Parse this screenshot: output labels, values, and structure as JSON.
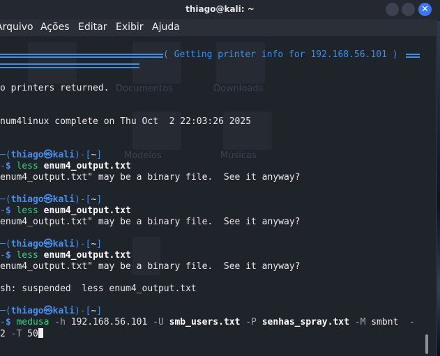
{
  "window": {
    "title": "thiago@kali: ~"
  },
  "menu": {
    "items": [
      "Arquivo",
      "Ações",
      "Editar",
      "Exibir",
      "Ajuda"
    ]
  },
  "desktop_ghost": {
    "documentos": "Documentos",
    "downloads": "Downloads",
    "modelos": "Modelos",
    "musicas": "Músicas"
  },
  "terminal": {
    "banner_text": "( Getting printer info for 192.168.56.101 )",
    "no_printers": "o printers returned.",
    "complete": "num4linux complete on Thu Oct  2 22:03:26 2025",
    "prompt": {
      "user": "thiago",
      "host": "kali",
      "dir": "~",
      "at": "㉿"
    },
    "commands": [
      {
        "cmd": "less",
        "arg": "enum4_output.txt",
        "response": "enum4_output.txt\" may be a binary file.  See it anyway?"
      },
      {
        "cmd": "less",
        "arg": "enum4_output.txt",
        "response": "enum4_output.txt\" may be a binary file.  See it anyway?"
      },
      {
        "cmd": "less",
        "arg": "enum4_output.txt",
        "response": "enum4_output.txt\" may be a binary file.  See it anyway?"
      }
    ],
    "suspended": "sh: suspended  less enum4_output.txt",
    "medusa": {
      "cmd": "medusa",
      "flag_h": "-h",
      "host": "192.168.56.101",
      "flag_U": "-U",
      "users": "smb_users.txt",
      "flag_P": "-P",
      "pass": "senhas_spray.txt",
      "flag_M": "-M",
      "module": "smbnt",
      "dash": "-",
      "cont_num": "2",
      "flag_T": "-T",
      "threads": "50"
    }
  }
}
